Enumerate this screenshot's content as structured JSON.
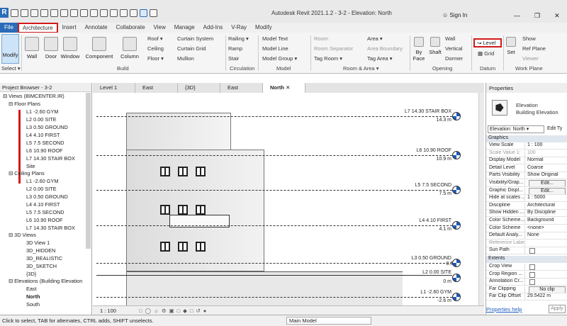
{
  "title": "Autodesk Revit 2021.1.2 - 3-2 - Elevation: North",
  "signin": "Sign In",
  "tabs": [
    "File",
    "Architecture",
    "Insert",
    "Annotate",
    "Collaborate",
    "View",
    "Manage",
    "Add-Ins",
    "V-Ray",
    "Modify"
  ],
  "ribbon": {
    "modify": "Modify",
    "select": "Select ▾",
    "build_big": [
      "Wall",
      "Door",
      "Window",
      "Component",
      "Column"
    ],
    "build_small": [
      "Roof ▾",
      "Ceiling",
      "Floor ▾",
      "Curtain System",
      "Curtain Grid",
      "Mullion"
    ],
    "circulation": [
      "Railing ▾",
      "Ramp",
      "Stair"
    ],
    "model": [
      "Model Text",
      "Model Line",
      "Model Group ▾"
    ],
    "room": [
      "Room",
      "Room Separator",
      "Tag Room ▾",
      "Area ▾",
      "Area Boundary",
      "Tag Area ▾"
    ],
    "opening": [
      "By Face",
      "Shaft",
      "Wall",
      "Vertical",
      "Dormer"
    ],
    "datum": [
      "Level",
      "Grid"
    ],
    "workplane": [
      "Set",
      "Show",
      "Ref Plane",
      "Viewer"
    ],
    "panels": [
      "Build",
      "Circulation",
      "Model",
      "Room & Area ▾",
      "Opening",
      "Datum",
      "Work Plane"
    ]
  },
  "project_browser": {
    "title": "Project Browser - 3-2",
    "root": "Views (BIMCENTER.IR)",
    "floor_plans_label": "Floor Plans",
    "floor_plans": [
      "L1 -2.60 GYM",
      "L2 0.00 SITE",
      "L3 0.50 GROUND",
      "L4 4.10 FIRST",
      "L5 7.5 SECOND",
      "L6 10.90 ROOF",
      "L7 14.30 STAIR BOX",
      "Site"
    ],
    "ceiling_label": "Ceiling Plans",
    "ceiling_plans": [
      "L1 -2.60 GYM",
      "L2 0.00 SITE",
      "L3 0.50 GROUND",
      "L4 4.10 FIRST",
      "L5 7.5 SECOND",
      "L6 10.90 ROOF",
      "L7 14.30 STAIR BOX"
    ],
    "views3d_label": "3D Views",
    "views3d": [
      "3D View 1",
      "3D_HIDDEN",
      "3D_REALISTIC",
      "3D_SKETCH",
      "{3D}"
    ],
    "elev_label": "Elevations (Building Elevation",
    "elevations": [
      "East",
      "North",
      "South"
    ]
  },
  "view_tabs": [
    "Level 1",
    "East",
    "{3D}",
    "East",
    "North"
  ],
  "levels": [
    {
      "name": "L7 14.30 STAIR BOX",
      "elev": "14.3 m"
    },
    {
      "name": "L6 10.90 ROOF",
      "elev": "10.9 m"
    },
    {
      "name": "L5 7.5 SECOND",
      "elev": "7.5 m"
    },
    {
      "name": "L4 4.10 FIRST",
      "elev": "4.1 m"
    },
    {
      "name": "L3 0.50 GROUND",
      "elev": "0.5 m"
    },
    {
      "name": "L2 0.00 SITE",
      "elev": "0 m"
    },
    {
      "name": "L1 -2.60 GYM",
      "elev": "-2.6 m"
    }
  ],
  "view_scale": "1 : 100",
  "properties": {
    "title": "Properties",
    "type1": "Elevation",
    "type2": "Building Elevation",
    "selector": "Elevation: North",
    "edit_type": "Edit Ty",
    "graphics": "Graphics",
    "rows": [
      [
        "View Scale",
        "1 : 100"
      ],
      [
        "Scale Value 1:",
        "100"
      ],
      [
        "Display Model",
        "Normal"
      ],
      [
        "Detail Level",
        "Coarse"
      ],
      [
        "Parts Visibility",
        "Show Original"
      ],
      [
        "Visibility/Grap...",
        "Edit..."
      ],
      [
        "Graphic Displ...",
        "Edit..."
      ],
      [
        "Hide at scales ...",
        "1 : 5000"
      ],
      [
        "Discipline",
        "Architectural"
      ],
      [
        "Show Hidden ...",
        "By Discipline"
      ],
      [
        "Color Scheme...",
        "Background"
      ],
      [
        "Color Scheme",
        "<none>"
      ],
      [
        "Default Analy...",
        "None"
      ],
      [
        "Reference Label",
        ""
      ],
      [
        "Sun Path",
        ""
      ]
    ],
    "extents": "Extents",
    "ext_rows": [
      [
        "Crop View",
        ""
      ],
      [
        "Crop Region ...",
        ""
      ],
      [
        "Annotation Cr...",
        ""
      ],
      [
        "Far Clipping",
        "No clip"
      ],
      [
        "Far Clip Offset",
        "29.5422 m"
      ]
    ],
    "help": "Properties help",
    "apply": "Apply"
  },
  "status": "Click to select, TAB for alternates, CTRL adds, SHIFT unselects.",
  "main_model": "Main Model"
}
